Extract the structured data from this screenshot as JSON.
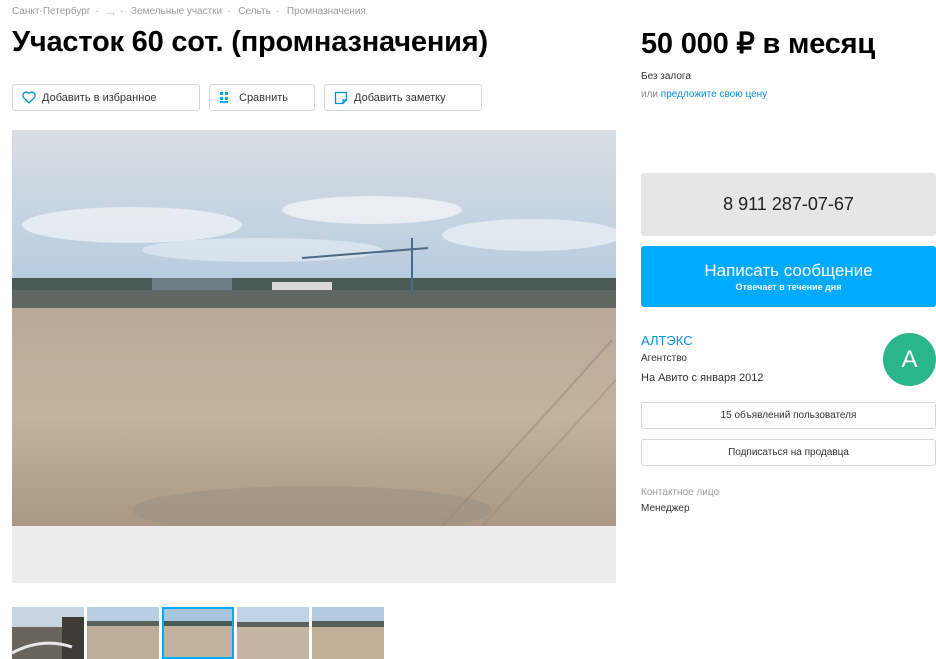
{
  "breadcrumb": [
    "Санкт-Петербург",
    "...",
    "Земельные участки",
    "Сельть",
    "Промназначения"
  ],
  "title": "Участок 60 сот. (промназначения)",
  "actions": {
    "favorite": "Добавить в избранное",
    "compare": "Сравнить",
    "note": "Добавить заметку"
  },
  "price": {
    "amount": "50 000 ₽ в месяц",
    "deposit": "Без залога",
    "offer_prefix": "или",
    "offer_link": "предложите свою цену"
  },
  "contact": {
    "phone": "8 911 287-07-67",
    "message_label": "Написать сообщение",
    "message_sub": "Отвечает в течение дня"
  },
  "seller": {
    "name": "АЛТЭКС",
    "type": "Агентство",
    "since": "На Авито с января 2012",
    "avatar_letter": "A",
    "avatar_color": "#2bb58a",
    "ads_button": "15 объявлений пользователя",
    "subscribe_button": "Подписаться на продавца",
    "contact_label": "Контактное лицо",
    "contact_name": "Менеджер"
  },
  "gallery": {
    "thumbnail_count": 5,
    "active_thumbnail": 3
  },
  "colors": {
    "accent": "#00aaff",
    "link": "#0091d9",
    "phone_bg": "#e6e6e6"
  },
  "icons": {
    "favorite": "heart-icon",
    "compare": "compare-icon",
    "note": "note-icon"
  }
}
